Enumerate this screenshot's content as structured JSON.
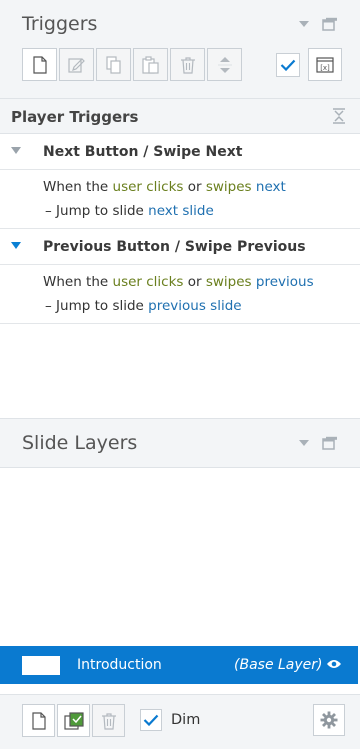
{
  "triggers_panel": {
    "title": "Triggers",
    "toolbar": {
      "new_icon": "new-page-icon",
      "edit_icon": "edit-icon",
      "copy_icon": "copy-icon",
      "paste_icon": "paste-icon",
      "delete_icon": "trash-icon",
      "move_icon": "up-down-arrows-icon"
    },
    "show_checked": true
  },
  "player_triggers": {
    "title": "Player Triggers",
    "items": [
      {
        "name": "Next Button / Swipe Next",
        "expanded": true,
        "when_prefix": "When the",
        "subject": "user clicks",
        "connector": "or",
        "action": "swipes",
        "target": "next",
        "step_dash": "–",
        "step_text": "Jump to slide",
        "step_target": "next slide"
      },
      {
        "name": "Previous Button / Swipe Previous",
        "expanded": true,
        "when_prefix": "When the",
        "subject": "user clicks",
        "connector": "or",
        "action": "swipes",
        "target": "previous",
        "step_dash": "–",
        "step_text": "Jump to slide",
        "step_target": "previous slide"
      }
    ]
  },
  "slide_layers": {
    "title": "Slide Layers",
    "layers": [
      {
        "name": "Introduction",
        "type": "(Base Layer)",
        "selected": true
      }
    ],
    "footer": {
      "dim_label": "Dim",
      "dim_checked": true
    }
  },
  "colors": {
    "accent": "#0a7ad0",
    "link_blue": "#1f70b0",
    "trigger_green": "#6a7f1e",
    "panel_bg": "#f3f5f7"
  }
}
